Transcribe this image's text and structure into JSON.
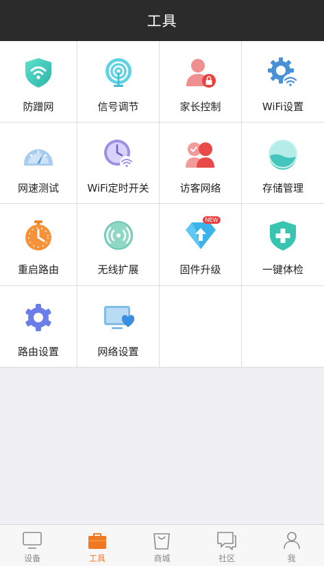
{
  "header": {
    "title": "工具"
  },
  "tools": [
    {
      "label": "防蹭网",
      "icon": "shield-wifi-icon"
    },
    {
      "label": "信号调节",
      "icon": "signal-icon"
    },
    {
      "label": "家长控制",
      "icon": "parent-lock-icon"
    },
    {
      "label": "WiFi设置",
      "icon": "wifi-gear-icon"
    },
    {
      "label": "网速测试",
      "icon": "speedometer-icon"
    },
    {
      "label": "WiFi定时开关",
      "icon": "clock-wifi-icon"
    },
    {
      "label": "访客网络",
      "icon": "guest-users-icon"
    },
    {
      "label": "存储管理",
      "icon": "storage-icon"
    },
    {
      "label": "重启路由",
      "icon": "stopwatch-icon"
    },
    {
      "label": "无线扩展",
      "icon": "wireless-extend-icon"
    },
    {
      "label": "固件升级",
      "icon": "firmware-upgrade-icon",
      "badge": "NEW"
    },
    {
      "label": "一键体检",
      "icon": "health-check-icon"
    },
    {
      "label": "路由设置",
      "icon": "router-gear-icon"
    },
    {
      "label": "网络设置",
      "icon": "network-monitor-icon"
    }
  ],
  "tabbar": {
    "items": [
      {
        "label": "设备",
        "icon": "device-icon"
      },
      {
        "label": "工具",
        "icon": "toolbox-icon",
        "active": true
      },
      {
        "label": "商城",
        "icon": "shopping-bag-icon"
      },
      {
        "label": "社区",
        "icon": "community-icon"
      },
      {
        "label": "我",
        "icon": "user-icon"
      }
    ]
  },
  "colors": {
    "header": "#2b2b2b",
    "accent": "#f07820",
    "background": "#efeff4"
  }
}
